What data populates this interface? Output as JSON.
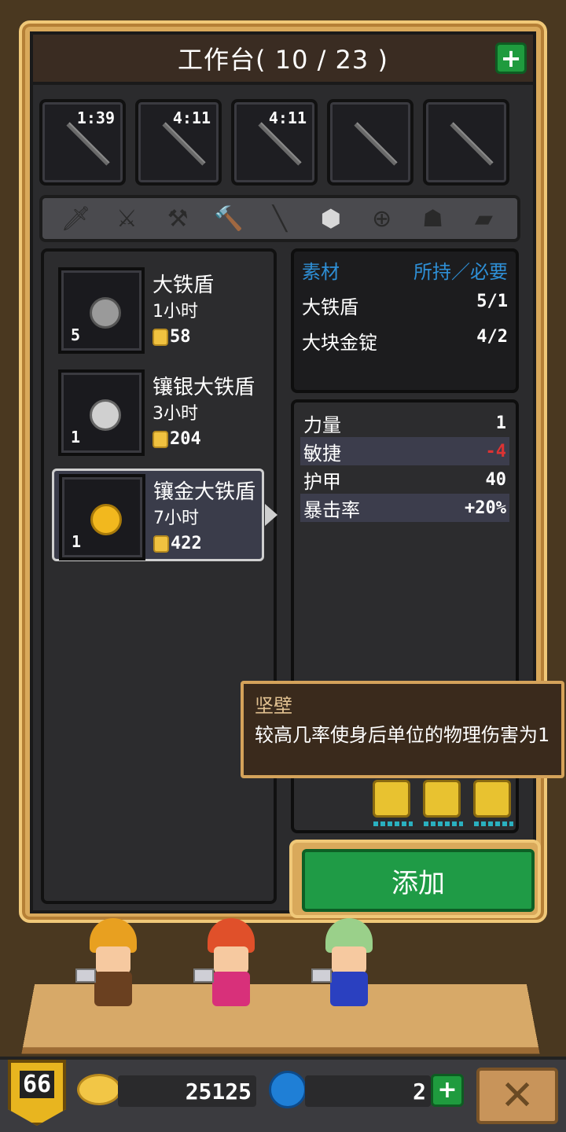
{
  "header": {
    "title": "工作台( 10 / 23 )",
    "add_icon": "plus-icon"
  },
  "slots": [
    {
      "timer": "1:39"
    },
    {
      "timer": "4:11"
    },
    {
      "timer": "4:11"
    },
    {
      "timer": ""
    },
    {
      "timer": ""
    }
  ],
  "categories": [
    "dagger",
    "sword",
    "axe",
    "hammer",
    "spear",
    "shield",
    "bow",
    "helmet",
    "armor"
  ],
  "active_category": "shield",
  "recipes": [
    {
      "name": "大铁盾",
      "time": "1小时",
      "cost": "58",
      "qty": "5",
      "color": "#9a9a9a",
      "selected": false
    },
    {
      "name": "镶银大铁盾",
      "time": "3小时",
      "cost": "204",
      "qty": "1",
      "color": "#cfcfcf",
      "selected": false
    },
    {
      "name": "镶金大铁盾",
      "time": "7小时",
      "cost": "422",
      "qty": "1",
      "color": "#f2b81e",
      "selected": true
    }
  ],
  "materials": {
    "header_left": "素材",
    "header_right": "所持／必要",
    "rows": [
      {
        "name": "大铁盾",
        "value": "5/1"
      },
      {
        "name": "大块金锭",
        "value": "4/2"
      }
    ]
  },
  "stats": [
    {
      "name": "力量",
      "value": "1"
    },
    {
      "name": "敏捷",
      "value": "-4"
    },
    {
      "name": "护甲",
      "value": "40"
    },
    {
      "name": "暴击率",
      "value": "+20%"
    }
  ],
  "tooltip": {
    "title": "坚壁",
    "desc": "较高几率使身后单位的物理伤害为1"
  },
  "add_button": "添加",
  "footer": {
    "level": "66",
    "gold": "25125",
    "gems": "2"
  }
}
